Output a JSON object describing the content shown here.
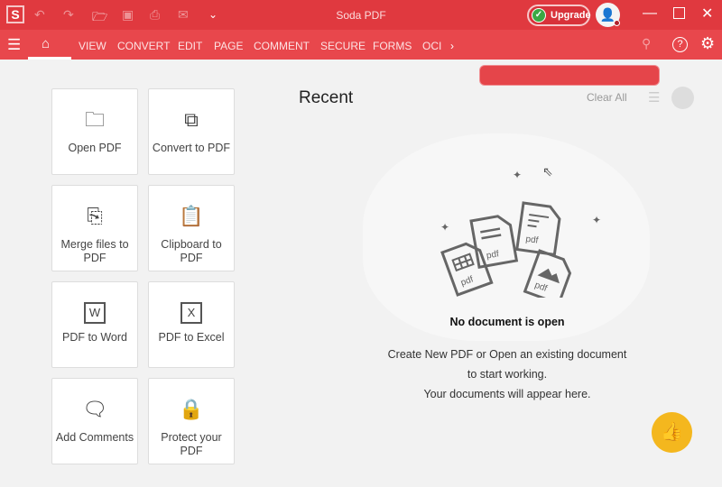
{
  "app": {
    "logo": "S",
    "title": "Soda PDF",
    "upgrade": "Upgrade"
  },
  "toolbar": {
    "icons": [
      "undo-icon",
      "redo-icon",
      "open-folder-icon",
      "save-icon",
      "print-icon",
      "mail-icon",
      "chevron-down-icon"
    ]
  },
  "nav": {
    "items": [
      "VIEW",
      "CONVERT",
      "EDIT",
      "PAGE",
      "COMMENT",
      "SECURE",
      "FORMS",
      "OCI"
    ],
    "search_placeholder": ""
  },
  "tiles": [
    {
      "label": "Open PDF",
      "icon": "folder-icon"
    },
    {
      "label": "Convert to PDF",
      "icon": "convert-icon"
    },
    {
      "label": "Merge files to PDF",
      "icon": "merge-icon"
    },
    {
      "label": "Clipboard to PDF",
      "icon": "clipboard-icon"
    },
    {
      "label": "PDF to Word",
      "icon": "word-icon"
    },
    {
      "label": "PDF to Excel",
      "icon": "excel-icon"
    },
    {
      "label": "Add Comments",
      "icon": "comment-icon"
    },
    {
      "label": "Protect your PDF",
      "icon": "lock-icon"
    }
  ],
  "recent": {
    "title": "Recent",
    "clear_all": "Clear All",
    "empty_title": "No document is open",
    "empty_line1": "Create New PDF or Open an existing document",
    "empty_line2": "to start working.",
    "empty_line3": "Your documents will appear here.",
    "illustration_label": "pdf"
  },
  "colors": {
    "titlebar": "#e0393f",
    "nav": "#e8474c",
    "accent": "#f4b71e"
  }
}
